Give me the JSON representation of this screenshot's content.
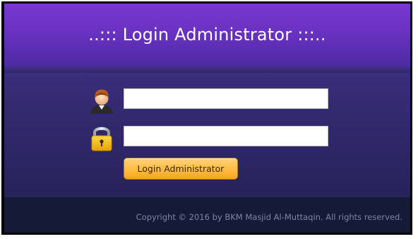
{
  "header": {
    "title": "..::: Login Administrator :::.."
  },
  "form": {
    "username": {
      "icon": "user-icon",
      "value": "",
      "placeholder": ""
    },
    "password": {
      "icon": "lock-icon",
      "value": "",
      "placeholder": ""
    },
    "submit_label": "Login Administrator"
  },
  "footer": {
    "copyright": "Copyright © 2016 by BKM Masjid Al-Muttaqin. All rights reserved."
  },
  "colors": {
    "header_top": "#7a38d0",
    "content_bg": "#2f2768",
    "footer_bg": "#151a37",
    "button_orange": "#ffc04a"
  }
}
